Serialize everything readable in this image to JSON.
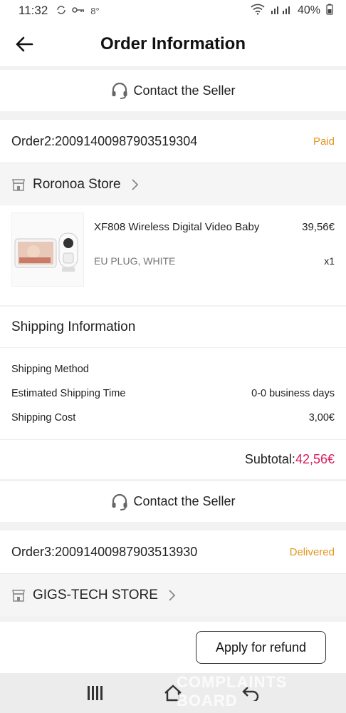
{
  "status_bar": {
    "time": "11:32",
    "notif_temp": "8°",
    "battery": "40%"
  },
  "header": {
    "title": "Order Information"
  },
  "contact_seller_label": "Contact the Seller",
  "order2": {
    "id": "Order2:20091400987903519304",
    "status": "Paid",
    "store": "Roronoa Store",
    "product": {
      "name": "XF808 Wireless Digital Video Baby",
      "variant": "EU PLUG, WHITE",
      "price": "39,56€",
      "qty": "x1"
    },
    "shipping": {
      "title": "Shipping Information",
      "method_label": "Shipping Method",
      "method_value": "",
      "time_label": "Estimated Shipping Time",
      "time_value": "0-0 business days",
      "cost_label": "Shipping Cost",
      "cost_value": "3,00€"
    },
    "subtotal_label": "Subtotal:",
    "subtotal_value": "42,56€"
  },
  "order3": {
    "id": "Order3:20091400987903513930",
    "status": "Delivered",
    "store": "GIGS-TECH STORE"
  },
  "refund_label": "Apply for refund",
  "watermark_text": "COMPLAINTS BOARD",
  "colors": {
    "status_accent": "#e2951f",
    "subtotal_accent": "#d81e5b"
  }
}
